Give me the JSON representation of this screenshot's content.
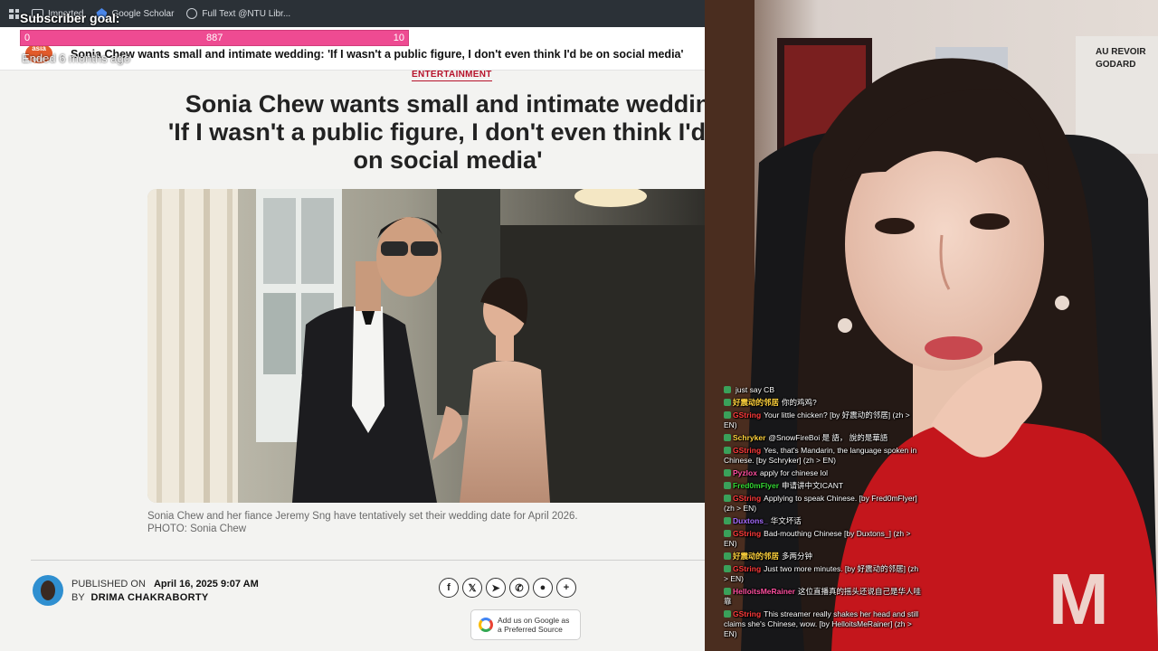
{
  "bookmarks": {
    "items": [
      {
        "label": "Imported"
      },
      {
        "label": "Google Scholar"
      },
      {
        "label": "Full Text @NTU Libr..."
      }
    ]
  },
  "overlay": {
    "goal_label": "Subscriber goal:",
    "goal_start": "0",
    "goal_current": "887",
    "goal_target": "10",
    "goal_color": "#ee4b92",
    "ended_text": "Ended 6 months ago"
  },
  "site": {
    "logo_text": "asia one",
    "header_headline": "Sonia Chew wants small and intimate wedding: 'If I wasn't a public figure, I don't even think I'd be on social media'"
  },
  "article": {
    "category": "ENTERTAINMENT",
    "title_line1": "Sonia Chew wants small and intimate weddin",
    "title_line2": "'If I wasn't a public figure, I don't even think I'd b",
    "title_line3": "on social media'",
    "caption_line1": "Sonia Chew and her fiance Jeremy Sng have tentatively set their wedding date for April 2026.",
    "caption_line2": "PHOTO: Sonia Chew",
    "published_label": "PUBLISHED ON",
    "published_date": "April 16, 2025 9:07 AM",
    "by_label": "BY",
    "author": "DRIMA CHAKRABORTY",
    "share_icons": [
      "facebook-icon",
      "x-icon",
      "telegram-icon",
      "whatsapp-icon",
      "reddit-icon",
      "plus-icon"
    ],
    "google_line1": "Add us on Google as",
    "google_line2": "a Preferred Source"
  },
  "webcam": {
    "poster_text": "AU REVOIR GODARD"
  },
  "chat": [
    {
      "user": "",
      "user_color": "#3b5bff",
      "text": "just say CB"
    },
    {
      "user": "好震动的邻居",
      "user_color": "#ffd23c",
      "text": "你的鸡鸡?"
    },
    {
      "user": "GString",
      "user_color": "#ff3b3b",
      "text": "Your little chicken? [by 好震动的邻居] (zh > EN)"
    },
    {
      "user": "Schryker",
      "user_color": "#ffd23c",
      "text": "@SnowFireBoi 是 語， 說的是華語"
    },
    {
      "user": "GString",
      "user_color": "#ff3b3b",
      "text": "Yes, that's Mandarin, the language spoken in Chinese. [by Schryker] (zh > EN)"
    },
    {
      "user": "Pyzlox",
      "user_color": "#ff4fa0",
      "text": "apply for chinese lol"
    },
    {
      "user": "Fred0mFlyer",
      "user_color": "#35d835",
      "text": "申请讲中文ICANT"
    },
    {
      "user": "GString",
      "user_color": "#ff3b3b",
      "text": "Applying to speak Chinese. [by Fred0mFlyer] (zh > EN)"
    },
    {
      "user": "Duxtons_",
      "user_color": "#a66cff",
      "text": "华文坏话"
    },
    {
      "user": "GString",
      "user_color": "#ff3b3b",
      "text": "Bad-mouthing Chinese [by Duxtons_] (zh > EN)"
    },
    {
      "user": "好震动的邻居",
      "user_color": "#ffd23c",
      "text": "多两分钟"
    },
    {
      "user": "GString",
      "user_color": "#ff3b3b",
      "text": "Just two more minutes. [by 好震动的邻居] (zh > EN)"
    },
    {
      "user": "HelloitsMeRainer",
      "user_color": "#ff4fa0",
      "text": "这位直播真的摇头还说自己是华人哇靠"
    },
    {
      "user": "GString",
      "user_color": "#ff3b3b",
      "text": "This streamer really shakes her head and still claims she's Chinese, wow. [by HelloitsMeRainer] (zh > EN)"
    }
  ]
}
